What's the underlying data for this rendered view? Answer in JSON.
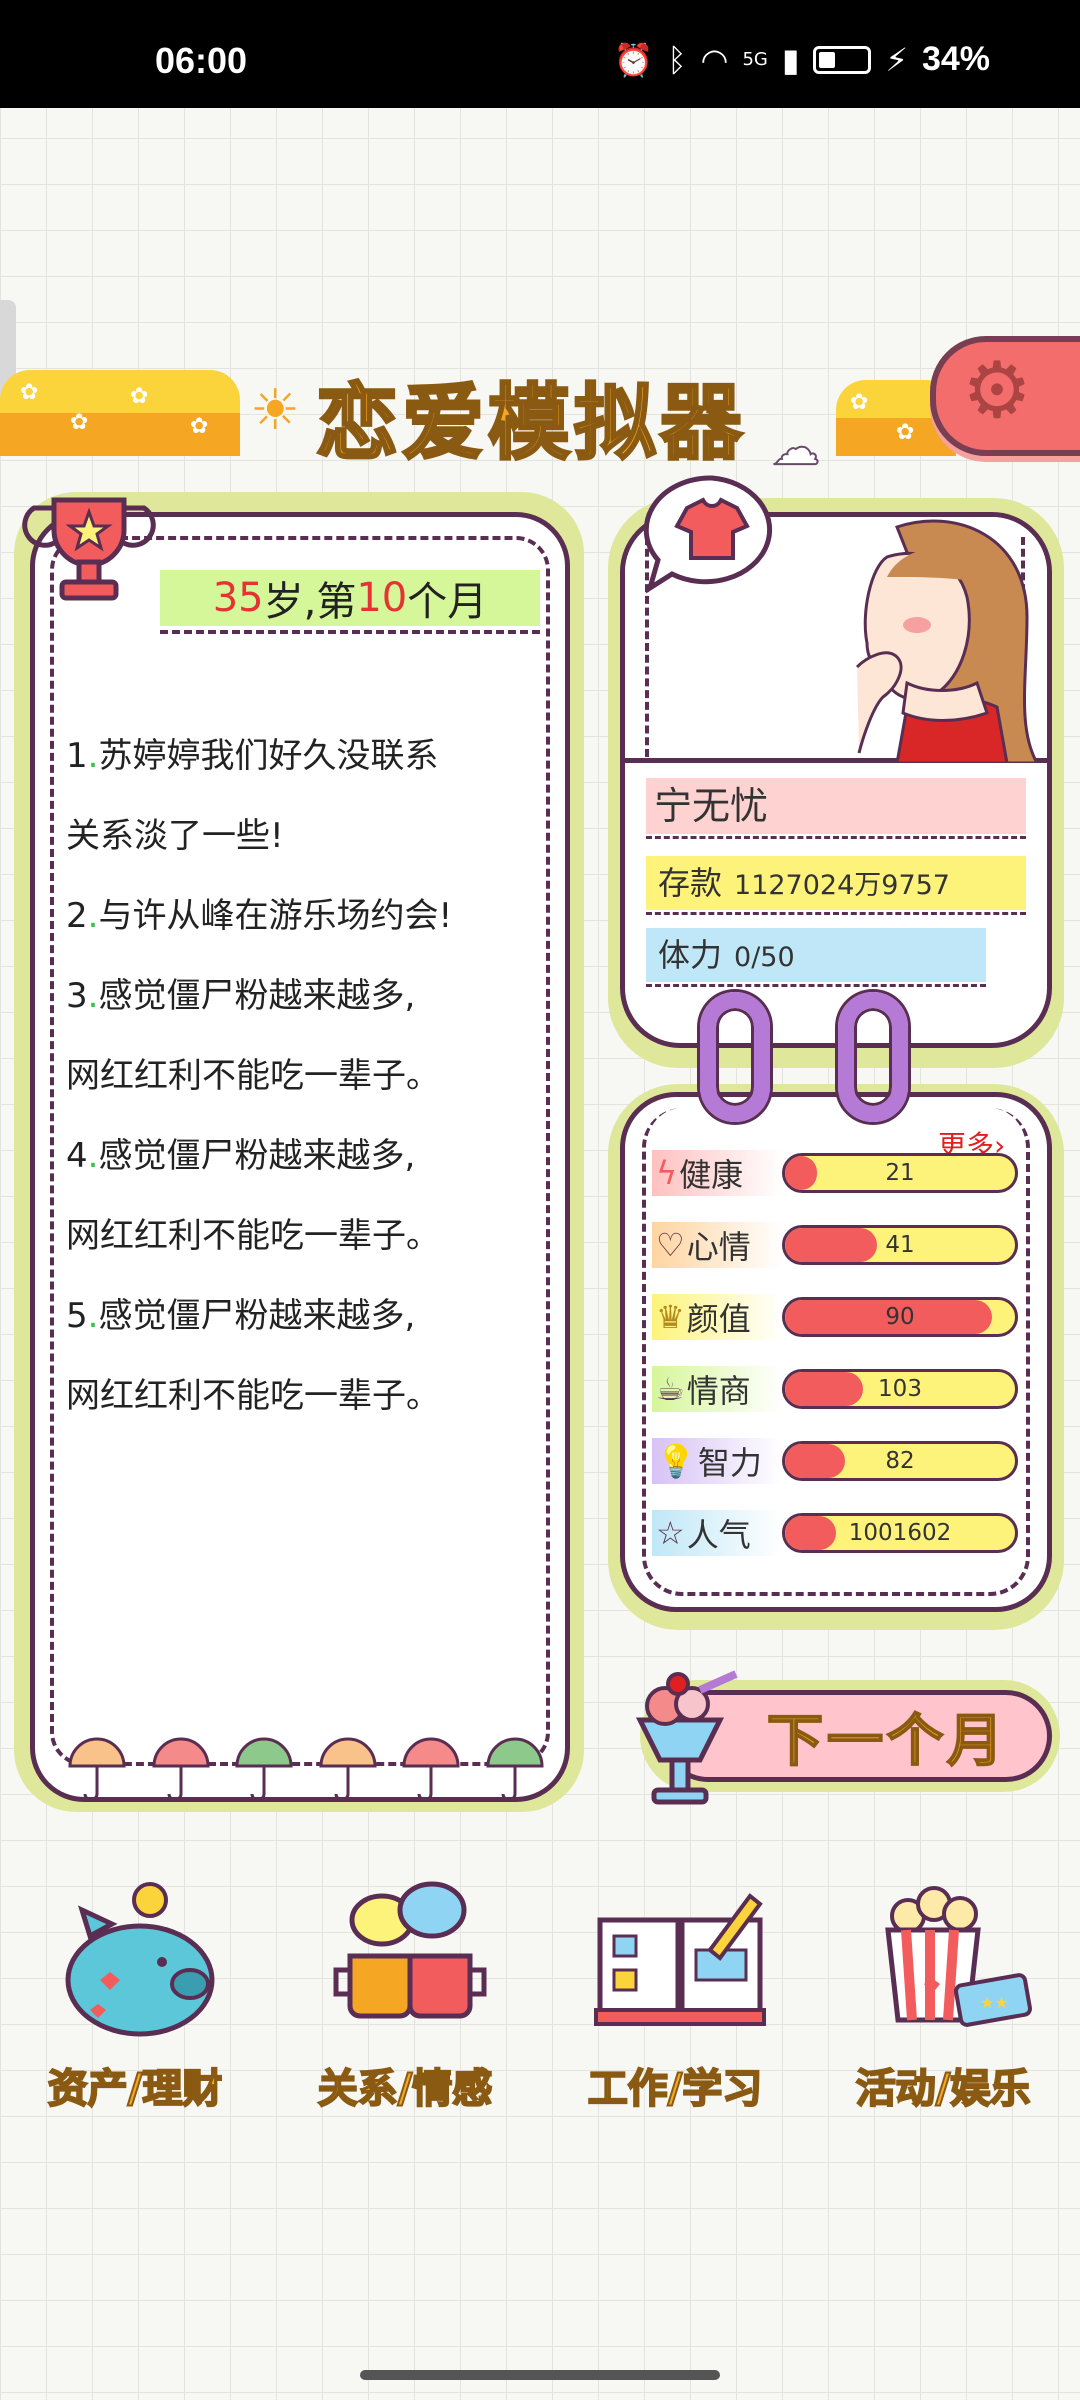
{
  "status_bar": {
    "time": "06:00",
    "network": "5G",
    "battery_pct": "34%",
    "icons": [
      "alarm-icon",
      "bluetooth-icon",
      "wifi-icon",
      "signal-icon",
      "battery-icon",
      "charging-icon"
    ]
  },
  "header": {
    "title": "恋爱模拟器",
    "settings_icon": "gear-icon"
  },
  "diary": {
    "age_num": "35",
    "age_mid": "岁,第",
    "month_num": "10",
    "month_suffix": "个月",
    "lines": [
      {
        "num": "1",
        "text": "苏婷婷我们好久没联系"
      },
      {
        "num": "",
        "text": "关系淡了一些!"
      },
      {
        "num": "2",
        "text": "与许从峰在游乐场约会!"
      },
      {
        "num": "3",
        "text": "感觉僵尸粉越来越多,"
      },
      {
        "num": "",
        "text": "网红红利不能吃一辈子。"
      },
      {
        "num": "4",
        "text": "感觉僵尸粉越来越多,"
      },
      {
        "num": "",
        "text": "网红红利不能吃一辈子。"
      },
      {
        "num": "5",
        "text": "感觉僵尸粉越来越多,"
      },
      {
        "num": "",
        "text": "网红红利不能吃一辈子。"
      }
    ]
  },
  "profile": {
    "name": "宁无忧",
    "savings_label": "存款",
    "savings_value": "1127024万9757",
    "stamina_label": "体力",
    "stamina_value": "0/50"
  },
  "stats": {
    "more_label": "更多›",
    "items": [
      {
        "label": "健康",
        "value": "21",
        "fill": 0.14,
        "icon": "lightning-icon"
      },
      {
        "label": "心情",
        "value": "41",
        "fill": 0.4,
        "icon": "heart-icon"
      },
      {
        "label": "颜值",
        "value": "90",
        "fill": 0.9,
        "icon": "crown-icon"
      },
      {
        "label": "情商",
        "value": "103",
        "fill": 0.34,
        "icon": "teacup-icon"
      },
      {
        "label": "智力",
        "value": "82",
        "fill": 0.26,
        "icon": "lightbulb-icon"
      },
      {
        "label": "人气",
        "value": "1001602",
        "fill": 0.22,
        "icon": "star-icon"
      }
    ]
  },
  "next_month": {
    "label": "下一个月"
  },
  "nav": [
    {
      "label": "资产/理财",
      "icon": "piggy-bank-icon"
    },
    {
      "label": "关系/情感",
      "icon": "chat-cups-icon"
    },
    {
      "label": "工作/学习",
      "icon": "book-pencil-icon"
    },
    {
      "label": "活动/娱乐",
      "icon": "popcorn-icon"
    }
  ],
  "colors": {
    "outline": "#5a2e52",
    "title_orange": "#f5a623",
    "bar_red": "#f25c5c",
    "bar_yellow": "#fdf37a",
    "panel_green": "#dfe89a"
  }
}
